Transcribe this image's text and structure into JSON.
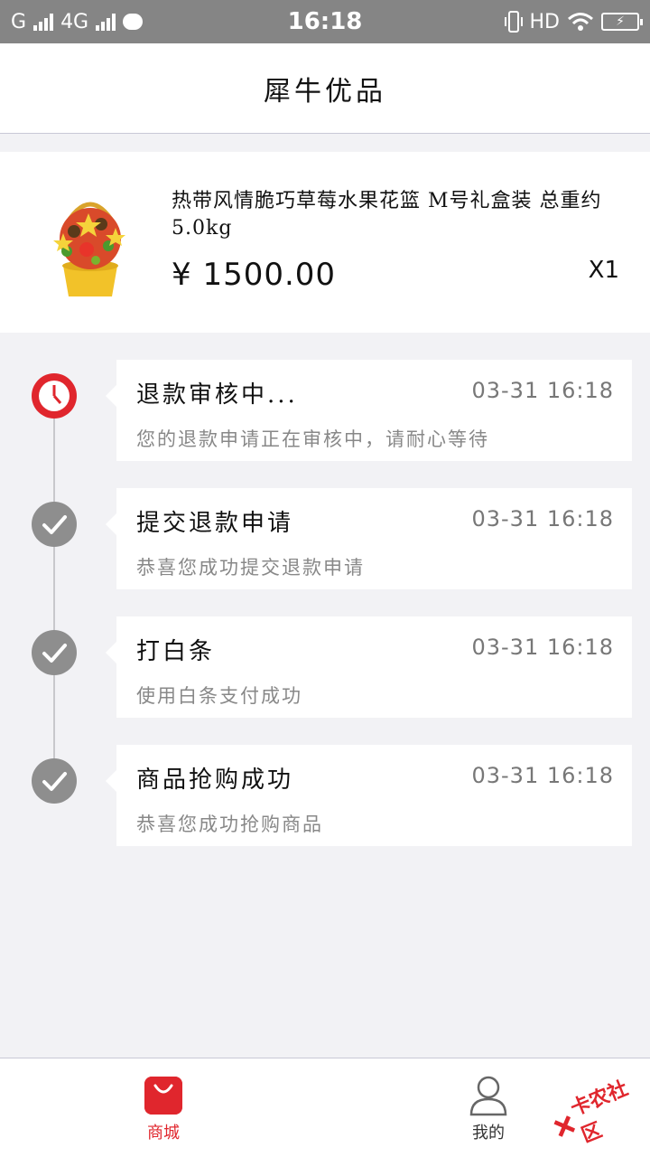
{
  "status_bar": {
    "carrier": "G",
    "network": "4G",
    "time": "16:18",
    "hd": "HD"
  },
  "header": {
    "title": "犀牛优品"
  },
  "product": {
    "name": "热带风情脆巧草莓水果花篮 M号礼盒装 总重约5.0kg",
    "price": "¥ 1500.00",
    "quantity": "X1"
  },
  "timeline": [
    {
      "title": "退款审核中...",
      "time": "03-31 16:18",
      "desc": "您的退款申请正在审核中，请耐心等待",
      "status": "pending",
      "icon": "clock-icon"
    },
    {
      "title": "提交退款申请",
      "time": "03-31 16:18",
      "desc": "恭喜您成功提交退款申请",
      "status": "done",
      "icon": "check-icon"
    },
    {
      "title": "打白条",
      "time": "03-31 16:18",
      "desc": "使用白条支付成功",
      "status": "done",
      "icon": "check-icon"
    },
    {
      "title": "商品抢购成功",
      "time": "03-31 16:18",
      "desc": "恭喜您成功抢购商品",
      "status": "done",
      "icon": "check-icon"
    }
  ],
  "nav": {
    "home_label": "商城",
    "me_label": "我的"
  },
  "watermark": {
    "text": "卡农社区"
  },
  "colors": {
    "accent": "#e0262d",
    "status_bar": "#858585",
    "done_node": "#8e8e8e"
  }
}
